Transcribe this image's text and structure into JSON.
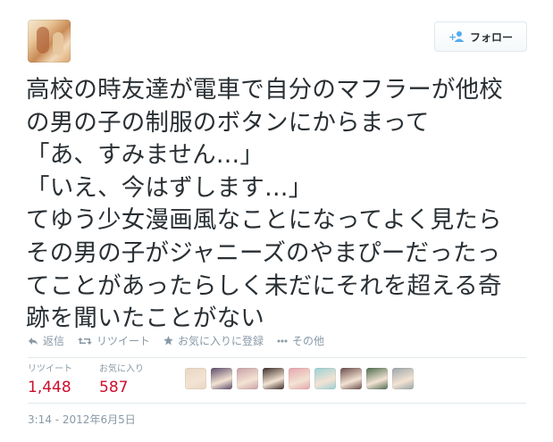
{
  "header": {
    "follow_label": "フォロー"
  },
  "tweet": {
    "lines": [
      "高校の時友達が電車で自分のマフラーが他校",
      "の男の子の制服のボタンにからまって",
      "「あ、すみません…」",
      "「いえ、今はずします…」",
      "てゆう少女漫画風なことになってよく見たら",
      "その男の子がジャニーズのやまぴーだったっ",
      "てことがあったらしく未だにそれを超える奇",
      "跡を聞いたことがない"
    ]
  },
  "actions": {
    "reply": "返信",
    "retweet": "リツイート",
    "favorite": "お気に入りに登録",
    "more": "その他"
  },
  "stats": {
    "retweets_label": "リツイート",
    "retweets_count": "1,448",
    "favorites_label": "お気に入り",
    "favorites_count": "587"
  },
  "favoriters": [
    {
      "icon": "user-avatar",
      "color": "#e9d6c3"
    },
    {
      "icon": "user-avatar",
      "color": "#5b4a6a"
    },
    {
      "icon": "user-avatar",
      "color": "#c9a0a8"
    },
    {
      "icon": "user-avatar",
      "color": "#3b2c2a"
    },
    {
      "icon": "user-avatar",
      "color": "#e6a4ad"
    },
    {
      "icon": "user-avatar",
      "color": "#9ad0d6"
    },
    {
      "icon": "user-avatar",
      "color": "#6b4b4a"
    },
    {
      "icon": "user-avatar",
      "color": "#4d6b50"
    },
    {
      "icon": "user-avatar",
      "color": "#9aa5a8"
    }
  ],
  "timestamp": "3:14 - 2012年6月5日",
  "colors": {
    "count": "#cc0f2c",
    "meta": "#8899a6",
    "text": "#292f33",
    "follow_icon": "#55acee"
  }
}
